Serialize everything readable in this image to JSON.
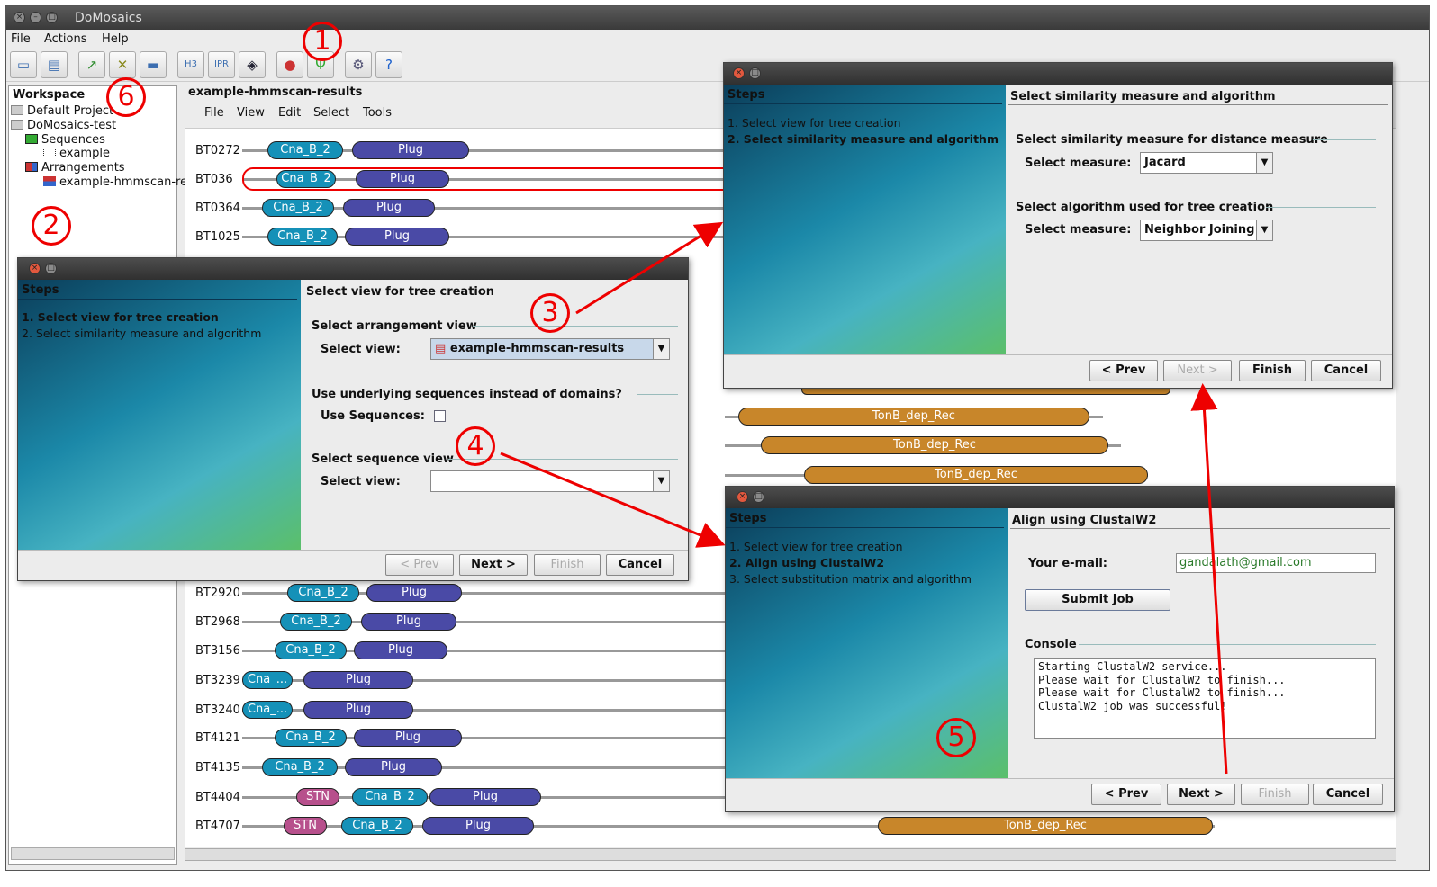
{
  "app": {
    "title": "DoMosaics"
  },
  "menu": [
    "File",
    "Actions",
    "Help"
  ],
  "toolbar": {
    "icons": [
      "open-icon",
      "save-icon",
      "import-icon",
      "tree-wizard-icon",
      "folder-icon",
      "hmmer3-icon",
      "ipr-icon",
      "shield-icon",
      "arrangement-icon",
      "tree-icon",
      "settings-icon",
      "help-icon"
    ]
  },
  "workspace": {
    "header": "Workspace",
    "tree": [
      "Default Project",
      "DoMosaics-test",
      "Sequences",
      "example",
      "Arrangements",
      "example-hmmscan-results"
    ]
  },
  "view": {
    "title": "example-hmmscan-results",
    "menu": [
      "File",
      "View",
      "Edit",
      "Select",
      "Tools"
    ],
    "rows": [
      {
        "id": "BT0272",
        "domains": [
          "Cna_B_2",
          "Plug"
        ]
      },
      {
        "id": "BT036",
        "domains": [
          "Cna_B_2",
          "Plug"
        ]
      },
      {
        "id": "BT0364",
        "domains": [
          "Cna_B_2",
          "Plug"
        ]
      },
      {
        "id": "BT1025",
        "domains": [
          "Cna_B_2",
          "Plug"
        ]
      },
      {
        "id": "BT2920",
        "domains": [
          "Cna_B_2",
          "Plug"
        ]
      },
      {
        "id": "BT2968",
        "domains": [
          "Cna_B_2",
          "Plug"
        ]
      },
      {
        "id": "BT3156",
        "domains": [
          "Cna_B_2",
          "Plug"
        ]
      },
      {
        "id": "BT3239",
        "domains": [
          "Cna_...",
          "Plug"
        ]
      },
      {
        "id": "BT3240",
        "domains": [
          "Cna_...",
          "Plug"
        ]
      },
      {
        "id": "BT4121",
        "domains": [
          "Cna_B_2",
          "Plug"
        ]
      },
      {
        "id": "BT4135",
        "domains": [
          "Cna_B_2",
          "Plug"
        ]
      },
      {
        "id": "BT4404",
        "domains": [
          "STN",
          "Cna_B_2",
          "Plug"
        ]
      },
      {
        "id": "BT4707",
        "domains": [
          "STN",
          "Cna_B_2",
          "Plug",
          "TonB_dep_Rec"
        ]
      }
    ],
    "tonb_label": "TonB_dep_Rec"
  },
  "dialog1": {
    "steps_header": "Steps",
    "steps": [
      "1. Select view for tree creation",
      "2. Select similarity measure and algorithm"
    ],
    "title": "Select view for tree creation",
    "section1": "Select arrangement view",
    "select_view_label": "Select view:",
    "select_view_value": "example-hmmscan-results",
    "section2": "Use underlying sequences instead of domains?",
    "use_seq_label": "Use Sequences:",
    "section3": "Select sequence view",
    "select_view2_label": "Select view:",
    "buttons": {
      "prev": "< Prev",
      "next": "Next >",
      "finish": "Finish",
      "cancel": "Cancel"
    }
  },
  "dialog2": {
    "steps_header": "Steps",
    "steps": [
      "1. Select view for tree creation",
      "2. Select similarity measure and algorithm"
    ],
    "title": "Select similarity measure and algorithm",
    "section1": "Select similarity measure for distance measure",
    "measure_label": "Select measure:",
    "measure_value": "Jacard",
    "section2": "Select algorithm used for tree creation",
    "algorithm_label": "Select measure:",
    "algorithm_value": "Neighbor Joining",
    "buttons": {
      "prev": "< Prev",
      "next": "Next >",
      "finish": "Finish",
      "cancel": "Cancel"
    }
  },
  "dialog3": {
    "steps_header": "Steps",
    "steps": [
      "1. Select view for tree creation",
      "2. Align using ClustalW2",
      "3. Select substitution matrix and algorithm"
    ],
    "title": "Align using ClustalW2",
    "email_label": "Your e-mail:",
    "email_value": "gandalath@gmail.com",
    "submit": "Submit Job",
    "console_label": "Console",
    "console_text": "Starting ClustalW2 service...\nPlease wait for ClustalW2 to finish...\nPlease wait for ClustalW2 to finish...\nClustalW2 job was successful!",
    "buttons": {
      "prev": "< Prev",
      "next": "Next >",
      "finish": "Finish",
      "cancel": "Cancel"
    }
  },
  "annotations": [
    "1",
    "2",
    "3",
    "4",
    "5",
    "6"
  ],
  "colors": {
    "annotation": "#e00000",
    "cna": "#1591b8",
    "plug": "#4a4aa6",
    "stn": "#b7508c",
    "tonb": "#c8862a"
  }
}
